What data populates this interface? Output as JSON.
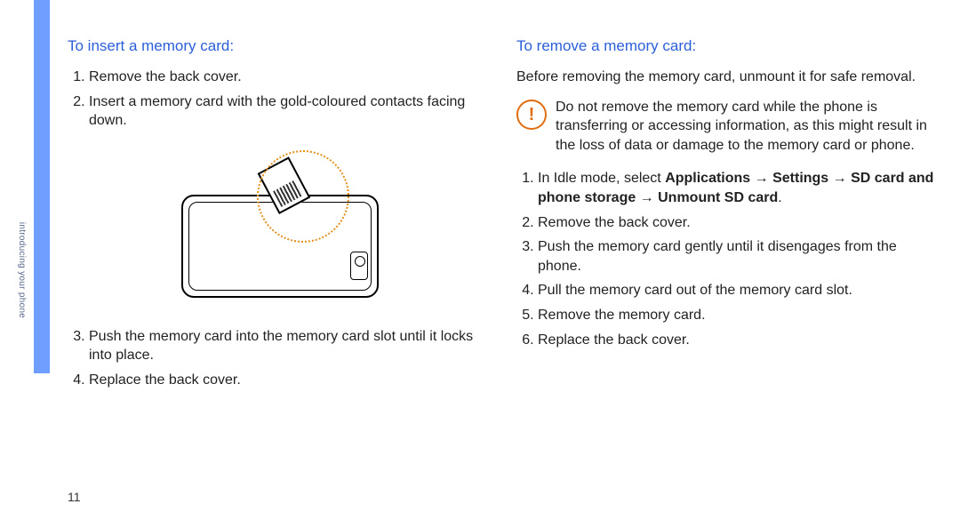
{
  "sidebar": {
    "label": "introducing your phone"
  },
  "page_number": "11",
  "left": {
    "heading": "To insert a memory card:",
    "steps": [
      "Remove the back cover.",
      "Insert a memory card with the gold-coloured contacts facing down.",
      "Push the memory card into the memory card slot until it locks into place.",
      "Replace the back cover."
    ],
    "image_alt": "phone-insert-sd-card-illustration"
  },
  "right": {
    "heading": "To remove a memory card:",
    "intro": "Before removing the memory card, unmount it for safe removal.",
    "warning_icon": "!",
    "warning_text": "Do not remove the memory card while the phone is transferring or accessing information, as this might result in the loss of data or damage to the memory card or phone.",
    "step1_prefix": "In Idle mode, select ",
    "step1_bold": "Applications → Settings → SD card and phone storage → Unmount SD card",
    "step1_suffix": ".",
    "steps_rest": [
      "Remove the back cover.",
      "Push the memory card gently until it disengages from the phone.",
      "Pull the memory card out of the memory card slot.",
      "Remove the memory card.",
      "Replace the back cover."
    ]
  }
}
